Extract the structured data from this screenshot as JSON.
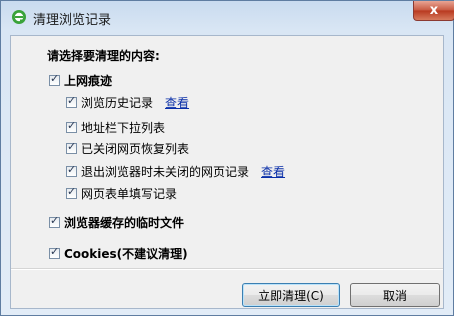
{
  "window": {
    "title": "清理浏览记录",
    "close_label": "x"
  },
  "section_heading": "请选择要清理的内容:",
  "groups": [
    {
      "label": "上网痕迹",
      "checked": true,
      "items": [
        {
          "label": "浏览历史记录",
          "checked": true,
          "link": "查看"
        },
        {
          "label": "地址栏下拉列表",
          "checked": true
        },
        {
          "label": "已关闭网页恢复列表",
          "checked": true
        },
        {
          "label": "退出浏览器时未关闭的网页记录",
          "checked": true,
          "link": "查看"
        },
        {
          "label": "网页表单填写记录",
          "checked": true
        }
      ]
    },
    {
      "label": "浏览器缓存的临时文件",
      "checked": true
    },
    {
      "label": "Cookies(不建议清理)",
      "checked": true
    }
  ],
  "buttons": {
    "clean_now": "立即清理(C)",
    "cancel": "取消"
  }
}
